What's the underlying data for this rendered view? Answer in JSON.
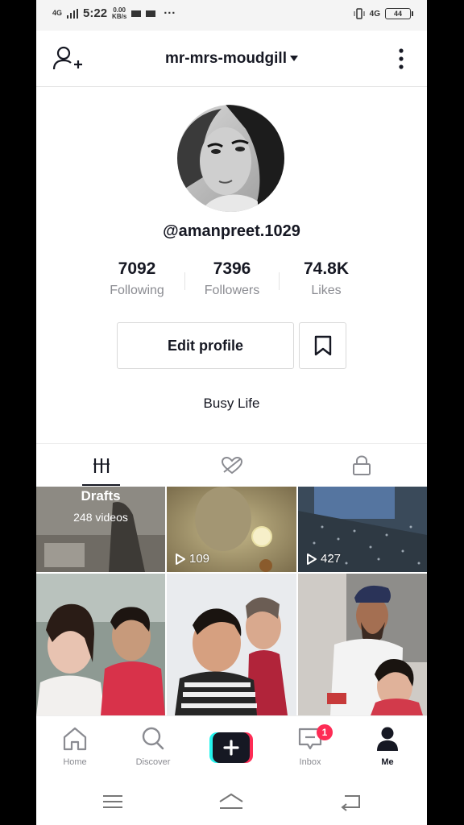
{
  "status_bar": {
    "network_left": "4G",
    "time": "5:22",
    "speed_value": "0.00",
    "speed_unit": "KB/s",
    "dots": "···",
    "network_right": "4G",
    "battery": "44"
  },
  "header": {
    "title": "mr-mrs-moudgill"
  },
  "profile": {
    "username": "@amanpreet.1029",
    "bio": "Busy Life",
    "edit_label": "Edit profile"
  },
  "stats": [
    {
      "value": "7092",
      "label": "Following"
    },
    {
      "value": "7396",
      "label": "Followers"
    },
    {
      "value": "74.8K",
      "label": "Likes"
    }
  ],
  "grid": {
    "drafts_title": "Drafts",
    "drafts_count": "248 videos",
    "videos": [
      {
        "views": "109"
      },
      {
        "views": "427"
      }
    ]
  },
  "nav": {
    "home": "Home",
    "discover": "Discover",
    "inbox": "Inbox",
    "inbox_badge": "1",
    "me": "Me"
  },
  "colors": {
    "accent": "#fe2c55",
    "cyan": "#25f4ee",
    "text": "#161823",
    "muted": "#8a8b91"
  },
  "icons": [
    "add-user-icon",
    "more-icon",
    "bookmark-icon",
    "grid-icon",
    "liked-icon",
    "lock-icon",
    "play-icon",
    "home-icon",
    "discover-icon",
    "plus-icon",
    "inbox-icon",
    "me-icon",
    "menu-icon",
    "home-key-icon",
    "back-icon"
  ]
}
